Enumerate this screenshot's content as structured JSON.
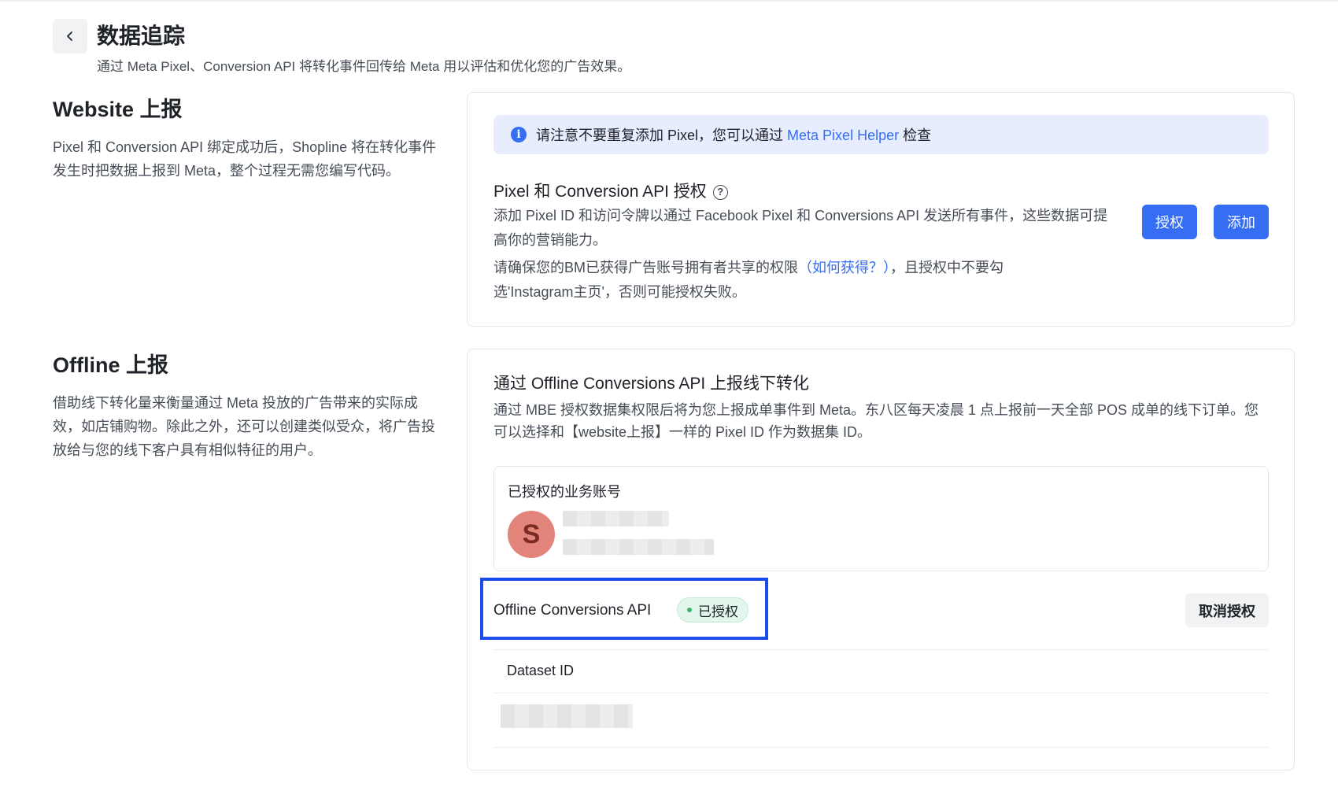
{
  "header": {
    "title": "数据追踪",
    "subtitle": "通过 Meta Pixel、Conversion API 将转化事件回传给 Meta 用以评估和优化您的广告效果。"
  },
  "website": {
    "title": "Website 上报",
    "desc": "Pixel 和 Conversion API 绑定成功后，Shopline 将在转化事件发生时把数据上报到 Meta，整个过程无需您编写代码。",
    "notice": {
      "text": "请注意不要重复添加 Pixel，您可以通过",
      "link": "Meta Pixel Helper",
      "suffix": "检查"
    },
    "auth": {
      "title": "Pixel 和 Conversion API 授权",
      "desc": "添加 Pixel ID 和访问令牌以通过 Facebook Pixel 和 Conversions API 发送所有事件，这些数据可提高你的营销能力。",
      "note_prefix": "请确保您的BM已获得广告账号拥有者共享的权限",
      "note_link": "（如何获得？）",
      "note_suffix": "，且授权中不要勾选'Instagram主页'，否则可能授权失败。",
      "authorize_button": "授权",
      "add_button": "添加"
    }
  },
  "offline": {
    "title": "Offline 上报",
    "desc": "借助线下转化量来衡量通过 Meta 投放的广告带来的实际成效，如店铺购物。除此之外，还可以创建类似受众，将广告投放给与您的线下客户具有相似特征的用户。",
    "card_title": "通过 Offline Conversions API 上报线下转化",
    "card_desc": "通过 MBE 授权数据集权限后将为您上报成单事件到 Meta。东八区每天凌晨 1 点上报前一天全部 POS 成单的线下订单。您可以选择和【website上报】一样的 Pixel ID 作为数据集 ID。",
    "account_label": "已授权的业务账号",
    "avatar_letter": "S",
    "api_label": "Offline Conversions API",
    "status_badge": "已授权",
    "revoke_button": "取消授权",
    "dataset_label": "Dataset ID"
  },
  "colors": {
    "primary": "#356df3",
    "notice_bg": "#e7edfe",
    "success": "#3bb36f",
    "highlight": "#1b4ee8",
    "avatar": "#e3847b"
  }
}
